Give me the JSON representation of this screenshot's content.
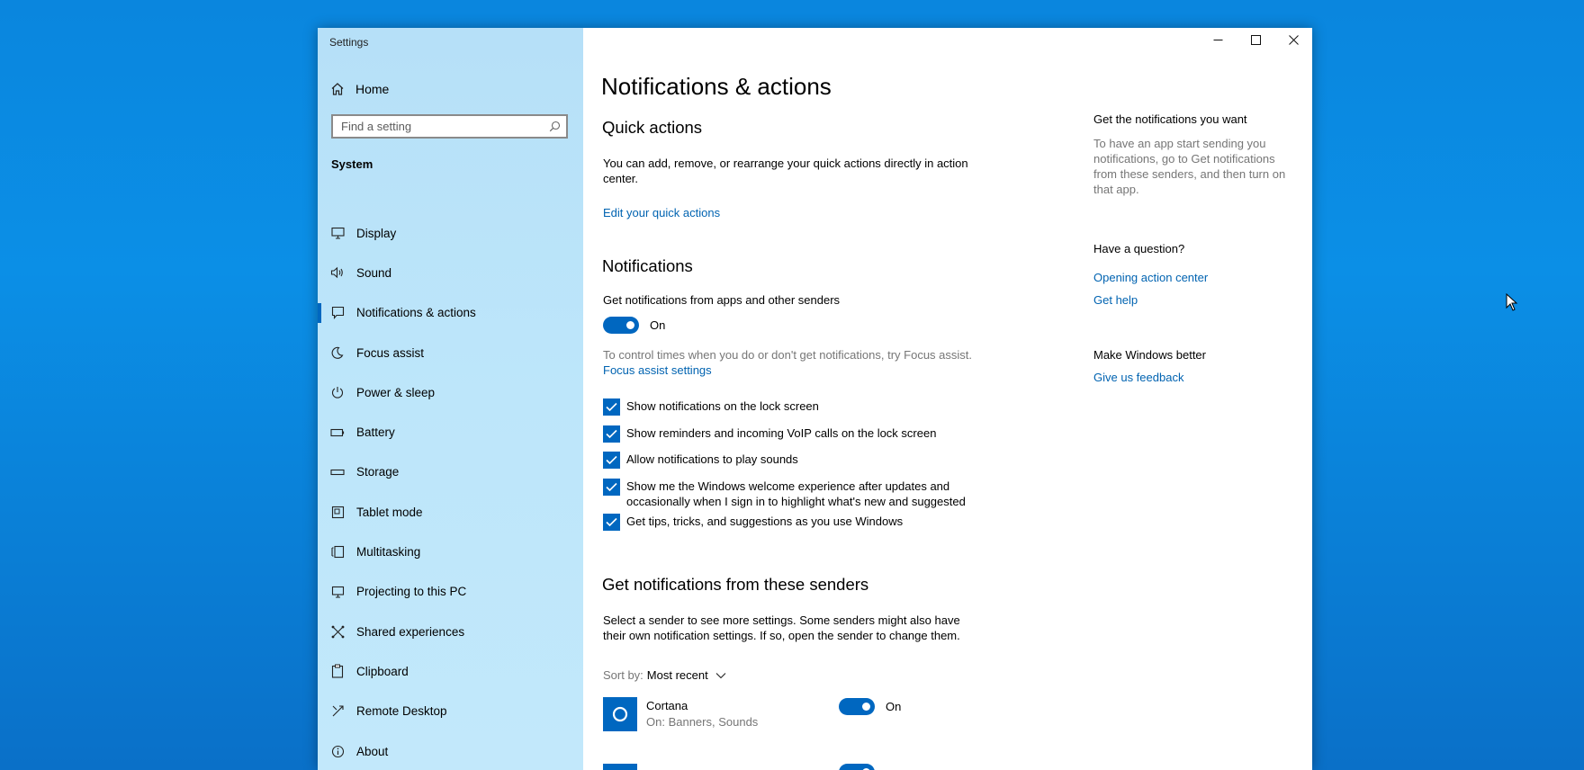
{
  "window": {
    "title": "Settings"
  },
  "sidebar": {
    "home_label": "Home",
    "search_placeholder": "Find a setting",
    "section_heading": "System",
    "items": [
      {
        "label": "Display",
        "icon": "monitor-icon"
      },
      {
        "label": "Sound",
        "icon": "speaker-icon"
      },
      {
        "label": "Notifications & actions",
        "icon": "notification-icon",
        "active": true
      },
      {
        "label": "Focus assist",
        "icon": "moon-icon"
      },
      {
        "label": "Power & sleep",
        "icon": "power-icon"
      },
      {
        "label": "Battery",
        "icon": "battery-icon"
      },
      {
        "label": "Storage",
        "icon": "storage-icon"
      },
      {
        "label": "Tablet mode",
        "icon": "tablet-mode-icon"
      },
      {
        "label": "Multitasking",
        "icon": "multitasking-icon"
      },
      {
        "label": "Projecting to this PC",
        "icon": "projecting-icon"
      },
      {
        "label": "Shared experiences",
        "icon": "shared-experiences-icon"
      },
      {
        "label": "Clipboard",
        "icon": "clipboard-icon"
      },
      {
        "label": "Remote Desktop",
        "icon": "remote-desktop-icon"
      },
      {
        "label": "About",
        "icon": "info-icon"
      }
    ]
  },
  "main": {
    "page_title": "Notifications & actions",
    "quick_actions": {
      "heading": "Quick actions",
      "description": "You can add, remove, or rearrange your quick actions directly in action center.",
      "link": "Edit your quick actions"
    },
    "notifications": {
      "heading": "Notifications",
      "toggle_label": "Get notifications from apps and other senders",
      "toggle_state": "On",
      "focus_hint": "To control times when you do or don't get notifications, try Focus assist.",
      "focus_link": "Focus assist settings",
      "checkboxes": [
        {
          "label": "Show notifications on the lock screen",
          "checked": true
        },
        {
          "label": "Show reminders and incoming VoIP calls on the lock screen",
          "checked": true
        },
        {
          "label": "Allow notifications to play sounds",
          "checked": true
        },
        {
          "label": "Show me the Windows welcome experience after updates and occasionally when I sign in to highlight what's new and suggested",
          "checked": true
        },
        {
          "label": "Get tips, tricks, and suggestions as you use Windows",
          "checked": true
        }
      ]
    },
    "senders": {
      "heading": "Get notifications from these senders",
      "description": "Select a sender to see more settings. Some senders might also have their own notification settings. If so, open the sender to change them.",
      "sort_label": "Sort by:",
      "sort_value": "Most recent",
      "list": [
        {
          "name": "Cortana",
          "detail": "On: Banners, Sounds",
          "state": "On"
        }
      ]
    }
  },
  "aside": {
    "get_notifications_heading": "Get the notifications you want",
    "get_notifications_text": "To have an app start sending you notifications, go to Get notifications from these senders, and then turn on that app.",
    "question_heading": "Have a question?",
    "links": [
      "Opening action center",
      "Get help"
    ],
    "feedback_heading": "Make Windows better",
    "feedback_link": "Give us feedback"
  },
  "colors": {
    "accent": "#0067c0",
    "link": "#0063b1",
    "sidebar_bg": "#bde6fa",
    "desktop_bg": "#0a86de"
  }
}
